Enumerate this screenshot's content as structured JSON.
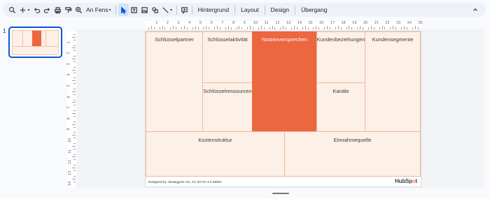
{
  "toolbar": {
    "zoom_label": "An Fens",
    "menu_background": "Hintergrund",
    "menu_layout": "Layout",
    "menu_design": "Design",
    "menu_transition": "Übergang"
  },
  "filmstrip": {
    "slide_number": "1"
  },
  "ruler": {
    "top": [
      "1",
      "2",
      "3",
      "4",
      "5",
      "6",
      "7",
      "8",
      "9",
      "10",
      "11",
      "12",
      "13",
      "14",
      "15",
      "16",
      "17",
      "18",
      "19",
      "20",
      "21",
      "22",
      "23",
      "24",
      "25"
    ],
    "left": [
      "1",
      "2",
      "3",
      "4",
      "5",
      "6",
      "7",
      "8",
      "9",
      "10",
      "11",
      "12",
      "13",
      "14"
    ]
  },
  "canvas_model": {
    "cells": {
      "partners": "Schlüsselpartner",
      "activities": "Schlüsselaktivität",
      "resources": "Schlüsselressourcen",
      "value": "Nutzenversprechen",
      "relationships": "Kundenbeziehungen",
      "channels": "Kanäle",
      "segments": "Kundensegmente",
      "costs": "Kostenstruktur",
      "revenue": "Einnahmequelle"
    },
    "credit": "Designed by: Strategyzer AG, CC BY-SA 4.0 DEED",
    "logo_text_a": "HubSp",
    "logo_text_b": "t"
  },
  "colors": {
    "accent": "#ec6640",
    "cell_fill": "#fdf0e6",
    "cell_border": "#f0b89a",
    "selection": "#0b57d0"
  }
}
